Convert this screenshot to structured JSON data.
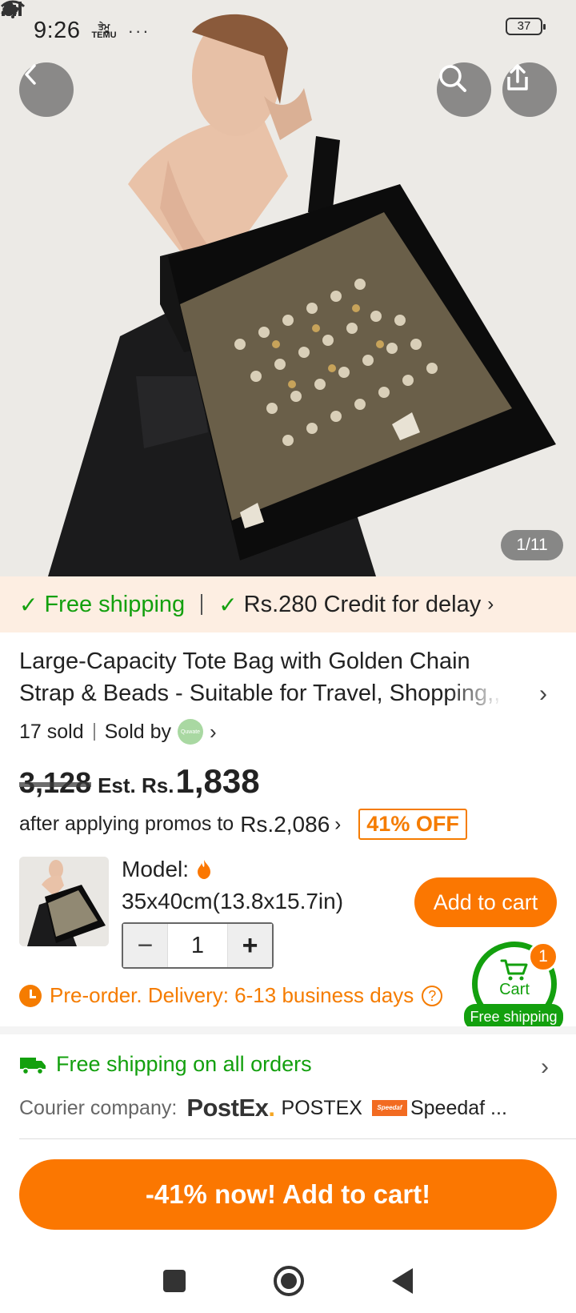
{
  "status_bar": {
    "time": "9:26",
    "mini_text": "ਤੇਮੂ\nTEMU",
    "battery": "37",
    "icons": [
      "snapchat-icon",
      "temu-icon",
      "cloud-icon",
      "more-icon",
      "signal-icon",
      "signal-icon",
      "wifi-icon",
      "battery-icon"
    ]
  },
  "hero": {
    "pager": "1/11",
    "icons": [
      "back-icon",
      "search-icon",
      "share-icon"
    ]
  },
  "promo_strip": {
    "free_shipping": "Free shipping",
    "credit": "Rs.280 Credit for delay"
  },
  "product": {
    "title": "Large-Capacity Tote Bag with Golden Chain Strap & Beads - Suitable for Travel, Shopping,, - Du",
    "sold": "17 sold",
    "sold_by": "Sold by",
    "seller_logo_text": "Quwate"
  },
  "price": {
    "original": "3,128",
    "est_label": "Est. Rs.",
    "estimated": "1,838",
    "promo_prefix": "after applying promos to",
    "promo_amount": "Rs.2,086",
    "discount_badge": "41% OFF"
  },
  "selector": {
    "model_label": "Model:",
    "model_value": "35x40cm(13.8x15.7in)",
    "quantity": "1",
    "minus": "−",
    "plus": "+",
    "add_to_cart": "Add to cart"
  },
  "delivery": {
    "text": "Pre-order. Delivery: 6-13 business days",
    "help": "?"
  },
  "cart_float": {
    "label": "Cart",
    "count": "1",
    "shipping": "Free shipping"
  },
  "shipping": {
    "title": "Free shipping on all orders",
    "courier_label": "Courier company:",
    "postex_logo": "PostEx",
    "postex_dot": ".",
    "postex_name": "POSTEX",
    "speedaf_logo": "Speedaf",
    "speedaf_name": "Speedaf ..."
  },
  "cta": {
    "label": "-41% now! Add to cart!"
  },
  "colors": {
    "accent_orange": "#fb7701",
    "green": "#13a00e",
    "promo_bg": "#fdeee2"
  }
}
